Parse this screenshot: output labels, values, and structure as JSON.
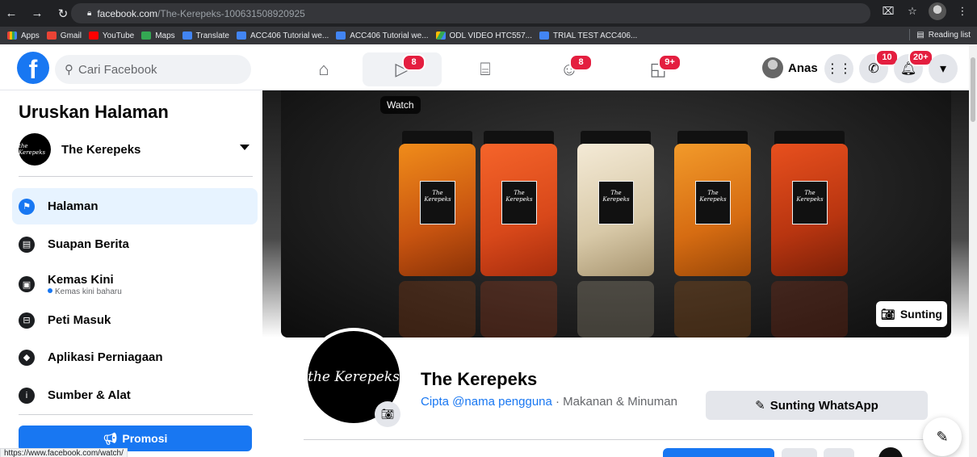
{
  "browser": {
    "url_host": "facebook.com",
    "url_path": "/The-Kerepeks-100631508920925",
    "bookmarks": [
      {
        "label": "Apps",
        "color": "#ea4335"
      },
      {
        "label": "Gmail",
        "color": "#ea4335"
      },
      {
        "label": "YouTube",
        "color": "#ff0000"
      },
      {
        "label": "Maps",
        "color": "#34a853"
      },
      {
        "label": "Translate",
        "color": "#4285f4"
      },
      {
        "label": "ACC406 Tutorial we...",
        "color": "#4285f4"
      },
      {
        "label": "ACC406 Tutorial we...",
        "color": "#4285f4"
      },
      {
        "label": "ODL VIDEO HTC557...",
        "color": "#fbbc04"
      },
      {
        "label": "TRIAL TEST ACC406...",
        "color": "#4285f4"
      }
    ],
    "reading_list": "Reading list",
    "status_url": "https://www.facebook.com/watch/"
  },
  "header": {
    "search_placeholder": "Cari Facebook",
    "nav": [
      {
        "icon": "home-icon",
        "badge": ""
      },
      {
        "icon": "watch-icon",
        "badge": "8"
      },
      {
        "icon": "marketplace-icon",
        "badge": ""
      },
      {
        "icon": "groups-icon",
        "badge": "8"
      },
      {
        "icon": "gaming-icon",
        "badge": "9+"
      }
    ],
    "tooltip": "Watch",
    "user_name": "Anas",
    "messenger_badge": "10",
    "notif_badge": "20+"
  },
  "sidebar": {
    "title": "Uruskan Halaman",
    "page_name": "The Kerepeks",
    "items": [
      {
        "label": "Halaman",
        "sub": ""
      },
      {
        "label": "Suapan Berita",
        "sub": ""
      },
      {
        "label": "Kemas Kini",
        "sub": "Kemas kini baharu"
      },
      {
        "label": "Peti Masuk",
        "sub": ""
      },
      {
        "label": "Aplikasi Perniagaan",
        "sub": ""
      },
      {
        "label": "Sumber & Alat",
        "sub": ""
      }
    ],
    "promo_label": "Promosi"
  },
  "main": {
    "cover_edit": "Sunting",
    "page_name": "The Kerepeks",
    "logo_text": "the Kerepeks",
    "jar_label": "The Kerepeks",
    "create_username": "Cipta @nama pengguna",
    "category": " · Makanan & Minuman",
    "whatsapp_button": "Sunting WhatsApp"
  },
  "colors": {
    "brand": "#1877f2",
    "badge": "#e41e3f"
  }
}
